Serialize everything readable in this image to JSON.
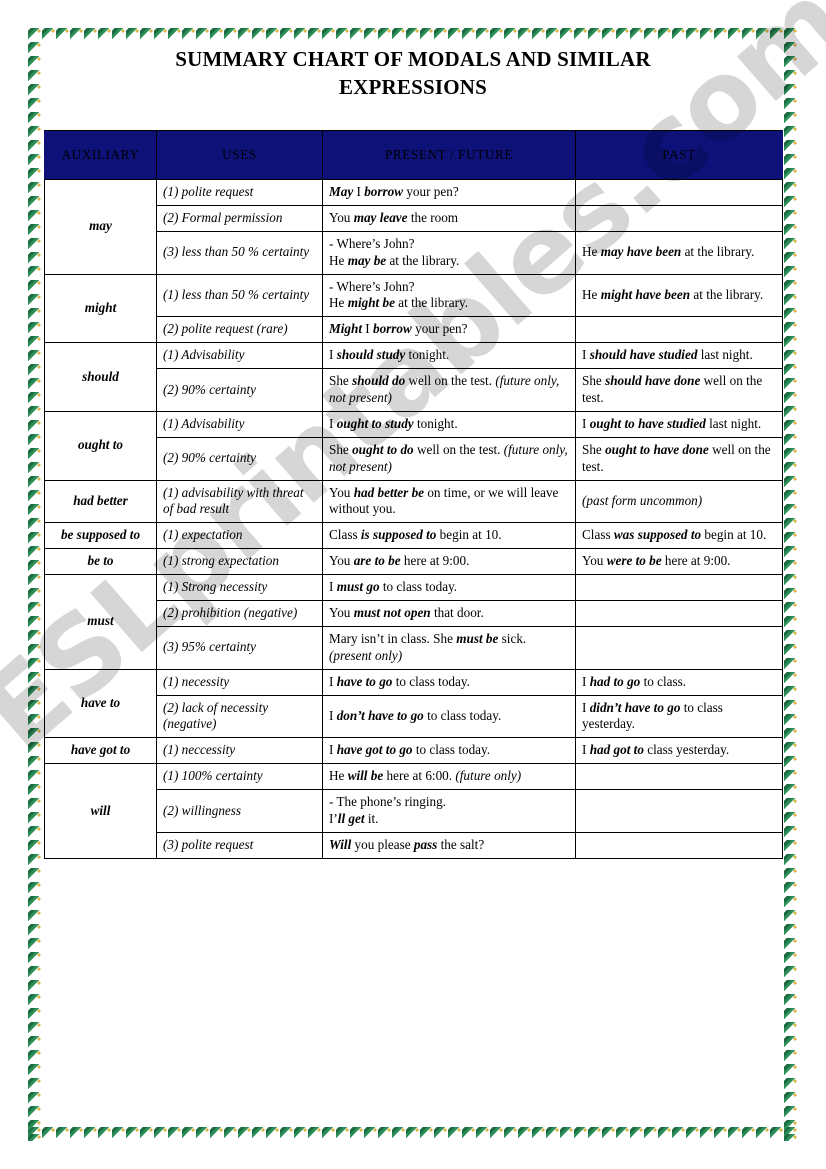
{
  "document": {
    "title_lines": [
      "SUMMARY CHART OF MODALS AND SIMILAR",
      "EXPRESSIONS"
    ],
    "watermark": "ESLprintables.com"
  },
  "colors": {
    "header_background": "#0d1178",
    "header_text": "#ffffff",
    "border_green": "#1d6b42",
    "border_accent": "#d8b34a",
    "table_line": "#000000"
  },
  "table": {
    "columns": [
      "AUXILIARY",
      "USES",
      "PRESENT / FUTURE",
      "PAST"
    ],
    "groups": [
      {
        "auxiliary": "may",
        "rows": [
          {
            "use": "(1) polite request",
            "present": [
              {
                "t": "May",
                "b": true
              },
              {
                "t": " I "
              },
              {
                "t": "borrow",
                "b": true
              },
              {
                "t": " your pen?"
              }
            ],
            "past": []
          },
          {
            "use": "(2) Formal permission",
            "present": [
              {
                "t": "You "
              },
              {
                "t": "may leave",
                "b": true
              },
              {
                "t": " the room"
              }
            ],
            "past": []
          },
          {
            "use": "(3) less than 50 % certainty",
            "present": [
              {
                "t": "- Where’s John?"
              },
              {
                "br": true
              },
              {
                "t": "He "
              },
              {
                "t": "may be",
                "b": true
              },
              {
                "t": " at the library."
              }
            ],
            "past": [
              {
                "t": "He "
              },
              {
                "t": "may have been",
                "b": true
              },
              {
                "t": " at the library."
              }
            ]
          }
        ]
      },
      {
        "auxiliary": "might",
        "rows": [
          {
            "use": "(1) less than 50 % certainty",
            "present": [
              {
                "t": "- Where’s John?"
              },
              {
                "br": true
              },
              {
                "t": "He "
              },
              {
                "t": "might be",
                "b": true
              },
              {
                "t": " at the library."
              }
            ],
            "past": [
              {
                "t": "He "
              },
              {
                "t": "might have been",
                "b": true
              },
              {
                "t": " at the library."
              }
            ]
          },
          {
            "use": "(2) polite request (rare)",
            "present": [
              {
                "t": "Might",
                "b": true
              },
              {
                "t": " I "
              },
              {
                "t": "borrow",
                "b": true
              },
              {
                "t": " your pen?"
              }
            ],
            "past": []
          }
        ]
      },
      {
        "auxiliary": "should",
        "rows": [
          {
            "use": "(1) Advisability",
            "present": [
              {
                "t": "I "
              },
              {
                "t": "should study",
                "b": true
              },
              {
                "t": " tonight."
              }
            ],
            "past": [
              {
                "t": "I "
              },
              {
                "t": "should have studied",
                "b": true
              },
              {
                "t": " last night."
              }
            ]
          },
          {
            "use": "(2) 90% certainty",
            "present": [
              {
                "t": "She "
              },
              {
                "t": "should do",
                "b": true
              },
              {
                "t": " well on the test. "
              },
              {
                "t": "(future only, not present)",
                "i": true
              }
            ],
            "past": [
              {
                "t": "She "
              },
              {
                "t": "should have done",
                "b": true
              },
              {
                "t": " well on the test."
              }
            ]
          }
        ]
      },
      {
        "auxiliary": "ought to",
        "rows": [
          {
            "use": "(1) Advisability",
            "present": [
              {
                "t": "I "
              },
              {
                "t": "ought to study",
                "b": true
              },
              {
                "t": " tonight."
              }
            ],
            "past": [
              {
                "t": "I "
              },
              {
                "t": "ought to have studied",
                "b": true
              },
              {
                "t": " last night."
              }
            ]
          },
          {
            "use": "(2) 90% certainty",
            "present": [
              {
                "t": "She "
              },
              {
                "t": "ought to do",
                "b": true
              },
              {
                "t": " well on the test. "
              },
              {
                "t": "(future only, not present)",
                "i": true
              }
            ],
            "past": [
              {
                "t": "She "
              },
              {
                "t": "ought to have done",
                "b": true
              },
              {
                "t": " well on the test."
              }
            ]
          }
        ]
      },
      {
        "auxiliary": "had better",
        "rows": [
          {
            "use": "(1) advisability with threat of bad result",
            "present": [
              {
                "t": "You "
              },
              {
                "t": "had better be",
                "b": true
              },
              {
                "t": " on time, or we will leave without you."
              }
            ],
            "past": [
              {
                "t": "(past form uncommon)",
                "i": true
              }
            ]
          }
        ]
      },
      {
        "auxiliary": "be supposed to",
        "rows": [
          {
            "use": "(1) expectation",
            "present": [
              {
                "t": "Class "
              },
              {
                "t": "is supposed to",
                "b": true
              },
              {
                "t": " begin at 10."
              }
            ],
            "past": [
              {
                "t": "Class "
              },
              {
                "t": "was supposed to",
                "b": true
              },
              {
                "t": " begin at 10."
              }
            ]
          }
        ]
      },
      {
        "auxiliary": "be to",
        "rows": [
          {
            "use": "(1) strong expectation",
            "present": [
              {
                "t": "You "
              },
              {
                "t": "are to be",
                "b": true
              },
              {
                "t": " here at 9:00."
              }
            ],
            "past": [
              {
                "t": "You "
              },
              {
                "t": "were to be",
                "b": true
              },
              {
                "t": " here at 9:00."
              }
            ]
          }
        ]
      },
      {
        "auxiliary": "must",
        "rows": [
          {
            "use": "(1) Strong necessity",
            "present": [
              {
                "t": "I "
              },
              {
                "t": "must go",
                "b": true
              },
              {
                "t": " to class today."
              }
            ],
            "past": []
          },
          {
            "use": "(2) prohibition (negative)",
            "present": [
              {
                "t": "You "
              },
              {
                "t": "must not open",
                "b": true
              },
              {
                "t": " that door."
              }
            ],
            "past": []
          },
          {
            "use": "(3) 95% certainty",
            "present": [
              {
                "t": "Mary isn’t in class. She "
              },
              {
                "t": "must be",
                "b": true
              },
              {
                "t": " sick. "
              },
              {
                "t": "(present only)",
                "i": true
              }
            ],
            "past": []
          }
        ]
      },
      {
        "auxiliary": "have to",
        "rows": [
          {
            "use": "(1) necessity",
            "present": [
              {
                "t": "I "
              },
              {
                "t": "have to go",
                "b": true
              },
              {
                "t": " to class today."
              }
            ],
            "past": [
              {
                "t": "I "
              },
              {
                "t": "had to go",
                "b": true
              },
              {
                "t": " to class."
              }
            ]
          },
          {
            "use": "(2) lack of necessity (negative)",
            "present": [
              {
                "t": "I "
              },
              {
                "t": "don’t have to go",
                "b": true
              },
              {
                "t": " to class today."
              }
            ],
            "past": [
              {
                "t": "I "
              },
              {
                "t": "didn’t have to go",
                "b": true
              },
              {
                "t": " to class yesterday."
              }
            ]
          }
        ]
      },
      {
        "auxiliary": "have got to",
        "rows": [
          {
            "use": "(1) neccessity",
            "present": [
              {
                "t": "I "
              },
              {
                "t": "have got to go",
                "b": true
              },
              {
                "t": " to class today."
              }
            ],
            "past": [
              {
                "t": "I "
              },
              {
                "t": "had got to",
                "b": true
              },
              {
                "t": " class yesterday."
              }
            ]
          }
        ]
      },
      {
        "auxiliary": "will",
        "rows": [
          {
            "use": "(1) 100% certainty",
            "present": [
              {
                "t": "He "
              },
              {
                "t": "will be",
                "b": true
              },
              {
                "t": " here at 6:00. "
              },
              {
                "t": "(future only)",
                "i": true
              }
            ],
            "past": []
          },
          {
            "use": "(2) willingness",
            "present": [
              {
                "t": "- The phone’s ringing."
              },
              {
                "br": true
              },
              {
                "t": "I’"
              },
              {
                "t": "ll get",
                "b": true
              },
              {
                "t": " it."
              }
            ],
            "past": []
          },
          {
            "use": "(3) polite request",
            "present": [
              {
                "t": "Will",
                "b": true
              },
              {
                "t": " you please "
              },
              {
                "t": "pass",
                "b": true
              },
              {
                "t": " the salt?"
              }
            ],
            "past": []
          }
        ]
      }
    ]
  }
}
